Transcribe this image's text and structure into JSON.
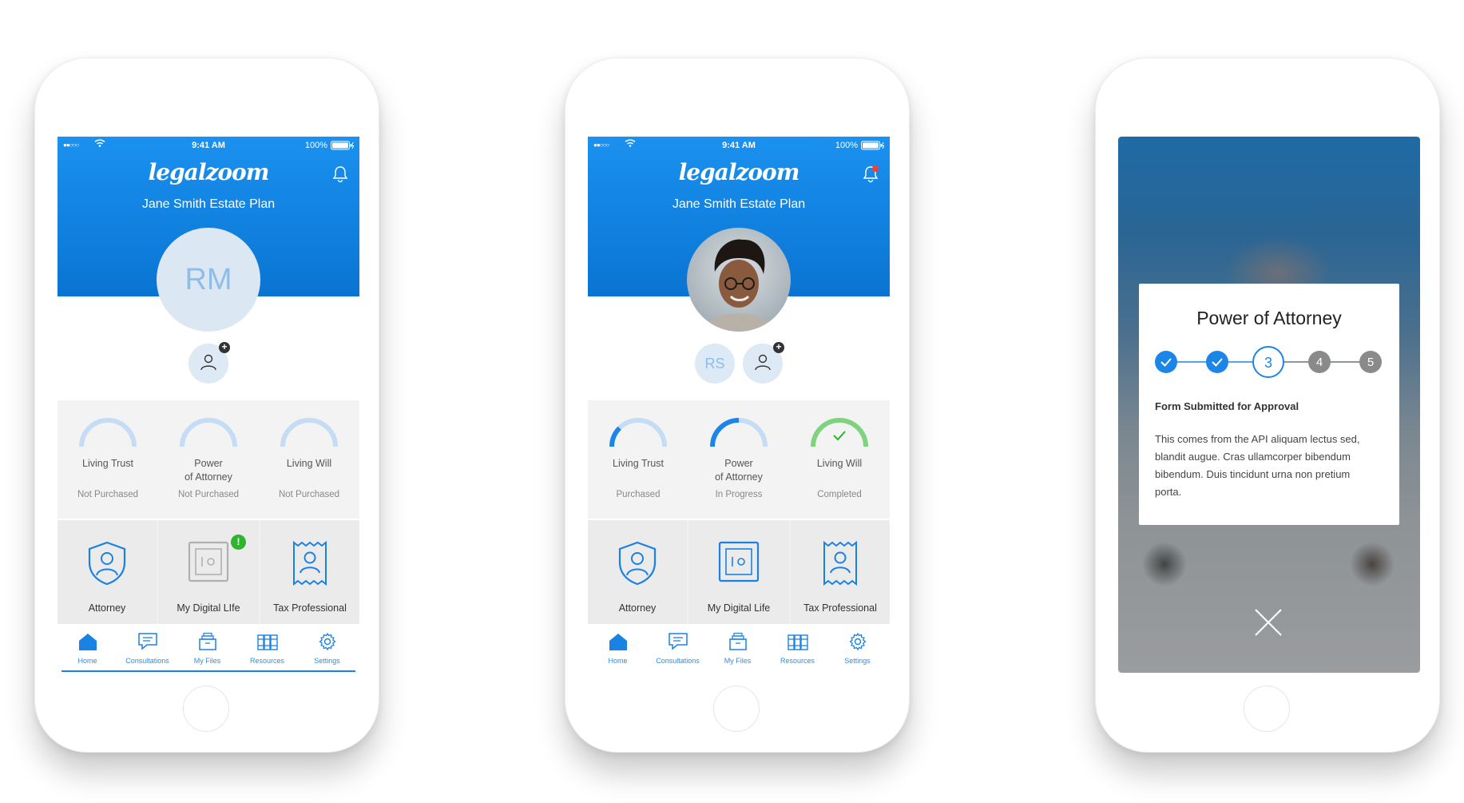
{
  "status_bar": {
    "signal": "●●○○○",
    "time": "9:41 AM",
    "battery": "100%"
  },
  "app": {
    "logo": "legalzoom",
    "plan_title": "Jane Smith Estate Plan"
  },
  "screen1": {
    "avatar_initials": "RM",
    "documents": [
      {
        "label": "Living Trust",
        "status": "Not Purchased",
        "progress": 0
      },
      {
        "label": "Power\nof Attorney",
        "status": "Not Purchased",
        "progress": 0
      },
      {
        "label": "Living Will",
        "status": "Not Purchased",
        "progress": 0
      }
    ],
    "tiles": [
      {
        "label": "Attorney",
        "icon": "shield-person-icon"
      },
      {
        "label": "My Digital LIfe",
        "icon": "vault-icon",
        "badge": "!"
      },
      {
        "label": "Tax Professional",
        "icon": "receipt-person-icon"
      }
    ]
  },
  "screen2": {
    "member_initials": "RS",
    "documents": [
      {
        "label": "Living Trust",
        "status": "Purchased",
        "progress": 0.25
      },
      {
        "label": "Power\nof Attorney",
        "status": "In Progress",
        "progress": 0.5
      },
      {
        "label": "Living Will",
        "status": "Completed",
        "progress": 1.0
      }
    ],
    "tiles": [
      {
        "label": "Attorney",
        "icon": "shield-person-icon"
      },
      {
        "label": "My Digital Life",
        "icon": "vault-icon"
      },
      {
        "label": "Tax Professional",
        "icon": "receipt-person-icon"
      }
    ]
  },
  "tabs": [
    {
      "label": "Home",
      "icon": "home-icon"
    },
    {
      "label": "Consultations",
      "icon": "chat-icon"
    },
    {
      "label": "My Files",
      "icon": "files-icon"
    },
    {
      "label": "Resources",
      "icon": "books-icon"
    },
    {
      "label": "Settings",
      "icon": "gear-icon"
    }
  ],
  "modal": {
    "title": "Power of Attorney",
    "steps": [
      "✓",
      "✓",
      "3",
      "4",
      "5"
    ],
    "current_step": 3,
    "subtitle": "Form Submitted for Approval",
    "body": "This comes from the API aliquam lectus sed, blandit augue. Cras ullamcorper bibendum bibendum. Duis tincidunt urna non pretium porta."
  },
  "colors": {
    "brand_blue": "#0d7ddb",
    "gauge_light": "#c5dcf5",
    "gauge_fill": "#1b86e8",
    "complete_green": "#7fd37f",
    "badge_green": "#2db52d",
    "step_grey": "#8a8a8a"
  }
}
